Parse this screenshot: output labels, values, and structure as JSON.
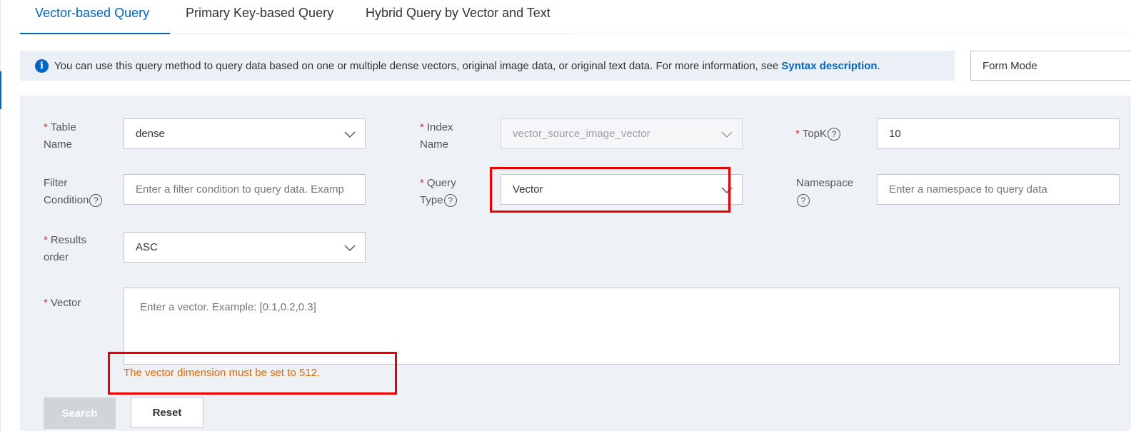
{
  "tabs": [
    {
      "label": "Vector-based Query",
      "active": true
    },
    {
      "label": "Primary Key-based Query",
      "active": false
    },
    {
      "label": "Hybrid Query by Vector and Text",
      "active": false
    }
  ],
  "info": {
    "text": "You can use this query method to query data based on one or multiple dense vectors, original image data, or original text data. For more information, see ",
    "link": "Syntax description",
    "suffix": "."
  },
  "mode": {
    "value": "Form Mode"
  },
  "form": {
    "table_name": {
      "label_line1": "Table",
      "label_line2": "Name",
      "value": "dense"
    },
    "index_name": {
      "label_line1": "Index",
      "label_line2": "Name",
      "value": "vector_source_image_vector"
    },
    "topk": {
      "label": "TopK",
      "value": "10"
    },
    "filter": {
      "label_line1": "Filter",
      "label_line2": "Condition",
      "placeholder": "Enter a filter condition to query data. Examp"
    },
    "query_type": {
      "label_line1": "Query",
      "label_line2": "Type",
      "value": "Vector"
    },
    "namespace": {
      "label": "Namespace",
      "placeholder": "Enter a namespace to query data"
    },
    "results_order": {
      "label_line1": "Results",
      "label_line2": "order",
      "value": "ASC"
    },
    "vector": {
      "label": "Vector",
      "placeholder": "Enter a vector. Example: [0.1,0.2,0.3]",
      "error": "The vector dimension must be set to 512."
    }
  },
  "buttons": {
    "search": "Search",
    "reset": "Reset"
  },
  "colors": {
    "accent": "#0064c8",
    "required": "#d93026",
    "error": "#e06a00",
    "highlight": "#ee0000"
  },
  "help_glyph": "?",
  "required_mark": "*",
  "info_icon_glyph": "i"
}
